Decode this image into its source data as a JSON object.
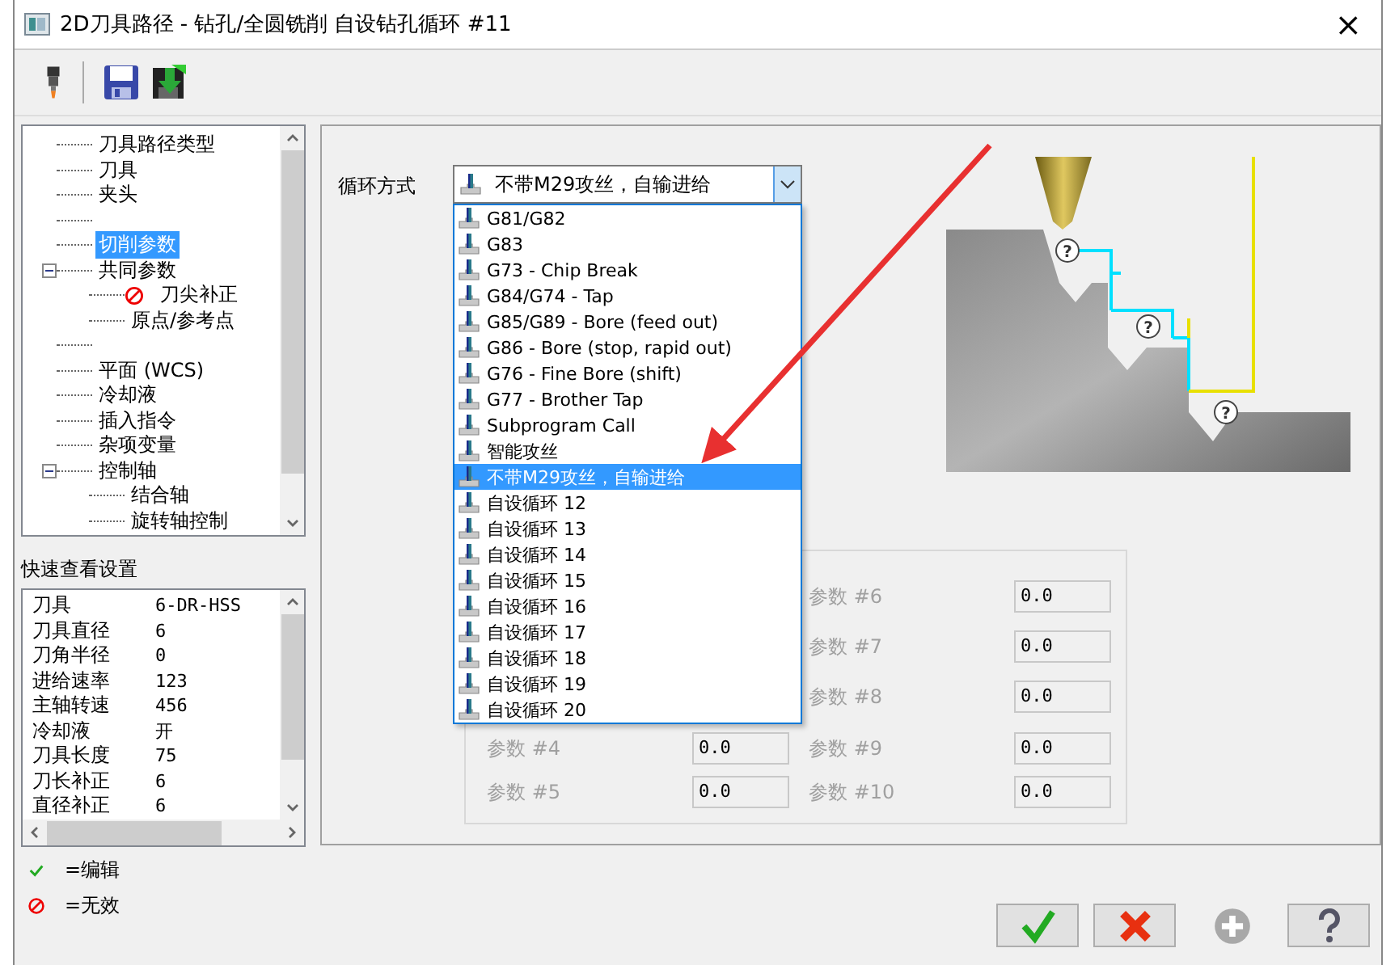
{
  "window": {
    "title": "2D刀具路径 - 钻孔/全圆铣削 自设钻孔循环 #11",
    "close": "×"
  },
  "tree": [
    {
      "kind": "page",
      "label": "刀具路径类型",
      "selected": false
    },
    {
      "kind": "page",
      "label": "刀具",
      "selected": false
    },
    {
      "kind": "page",
      "label": "夹头",
      "selected": false
    },
    {
      "kind": "spacer"
    },
    {
      "kind": "page",
      "label": "切削参数",
      "selected": true
    },
    {
      "kind": "page",
      "label": "共同参数",
      "selected": false,
      "expanded": true,
      "children": [
        {
          "kind": "invalid",
          "label": "刀尖补正",
          "selected": false
        },
        {
          "kind": "page",
          "label": "原点/参考点",
          "selected": false
        }
      ]
    },
    {
      "kind": "spacer"
    },
    {
      "kind": "page",
      "label": "平面 (WCS)",
      "selected": false
    },
    {
      "kind": "page",
      "label": "冷却液",
      "selected": false
    },
    {
      "kind": "page",
      "label": "插入指令",
      "selected": false
    },
    {
      "kind": "page",
      "label": "杂项变量",
      "selected": false
    },
    {
      "kind": "page",
      "label": "控制轴",
      "selected": false,
      "expanded": true,
      "children": [
        {
          "kind": "page",
          "label": "结合轴",
          "selected": false
        },
        {
          "kind": "page",
          "label": "旋转轴控制",
          "selected": false
        }
      ]
    }
  ],
  "quick_view": {
    "title": "快速查看设置",
    "rows": [
      {
        "label": "刀具",
        "value": "6-DR-HSS"
      },
      {
        "label": "刀具直径",
        "value": "6"
      },
      {
        "label": "刀角半径",
        "value": "0"
      },
      {
        "label": "进给速率",
        "value": "123"
      },
      {
        "label": "主轴转速",
        "value": "456"
      },
      {
        "label": "冷却液",
        "value": "开"
      },
      {
        "label": "刀具长度",
        "value": "75"
      },
      {
        "label": "刀长补正",
        "value": "6"
      },
      {
        "label": "直径补正",
        "value": "6"
      }
    ]
  },
  "legend": [
    {
      "kind": "edited",
      "label": "=编辑"
    },
    {
      "kind": "invalid",
      "label": "=无效"
    }
  ],
  "cycle": {
    "label": "循环方式",
    "value": "不带M29攻丝，自输进给",
    "options": [
      {
        "label": "G81/G82",
        "selected": false
      },
      {
        "label": "G83",
        "selected": false
      },
      {
        "label": "G73 - Chip Break",
        "selected": false
      },
      {
        "label": "G84/G74 - Tap",
        "selected": false
      },
      {
        "label": "G85/G89 - Bore (feed out)",
        "selected": false
      },
      {
        "label": "G86 - Bore (stop, rapid out)",
        "selected": false
      },
      {
        "label": "G76 - Fine Bore (shift)",
        "selected": false
      },
      {
        "label": "G77 - Brother Tap",
        "selected": false
      },
      {
        "label": "Subprogram Call",
        "selected": false
      },
      {
        "label": "智能攻丝",
        "selected": false
      },
      {
        "label": "不带M29攻丝，自输进给",
        "selected": true
      },
      {
        "label": "自设循环 12",
        "selected": false
      },
      {
        "label": "自设循环 13",
        "selected": false
      },
      {
        "label": "自设循环 14",
        "selected": false
      },
      {
        "label": "自设循环 15",
        "selected": false
      },
      {
        "label": "自设循环 16",
        "selected": false
      },
      {
        "label": "自设循环 17",
        "selected": false
      },
      {
        "label": "自设循环 18",
        "selected": false
      },
      {
        "label": "自设循环 19",
        "selected": false
      },
      {
        "label": "自设循环 20",
        "selected": false
      }
    ]
  },
  "diagram": {
    "markers": [
      "?",
      "?",
      "?"
    ]
  },
  "parameters": {
    "disabled": true,
    "left": [
      {
        "label": "参数 #4",
        "value": "0.0"
      },
      {
        "label": "参数 #5",
        "value": "0.0"
      }
    ],
    "right": [
      {
        "label": "参数 #6",
        "value": "0.0"
      },
      {
        "label": "参数 #7",
        "value": "0.0"
      },
      {
        "label": "参数 #8",
        "value": "0.0"
      },
      {
        "label": "参数 #9",
        "value": "0.0"
      },
      {
        "label": "参数 #10",
        "value": "0.0"
      }
    ]
  },
  "buttons": [
    {
      "kind": "ok",
      "disabled": false
    },
    {
      "kind": "cancel",
      "disabled": false
    },
    {
      "kind": "add",
      "disabled": true
    },
    {
      "kind": "help",
      "disabled": false
    }
  ]
}
